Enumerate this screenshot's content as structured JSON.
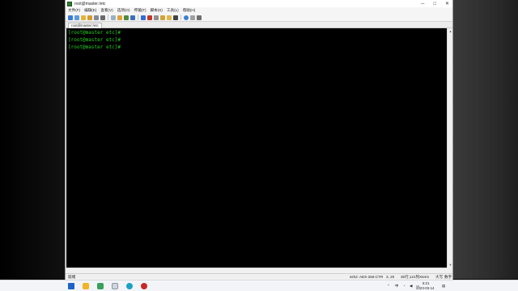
{
  "window": {
    "title": "root@master:/etc",
    "controls": {
      "minimize": "─",
      "maximize": "□",
      "close": "✕"
    }
  },
  "menu": [
    "文件(F)",
    "编辑(E)",
    "查看(V)",
    "选项(O)",
    "传输(T)",
    "脚本(S)",
    "工具(L)",
    "帮助(H)"
  ],
  "tab": {
    "label": "root@master:/etc"
  },
  "terminal": {
    "lines": [
      "[root@master etc]#",
      "[root@master etc]#",
      "[root@master etc]#"
    ],
    "text_color": "#22d022"
  },
  "status": {
    "left": "就绪",
    "cipher": "ssh2: AES-256-CTR",
    "cursor": "3, 20",
    "size": "35行,121列",
    "term": "Xterm",
    "caps": "大写",
    "num": "数字"
  },
  "taskbar": {
    "time": "8:21",
    "date": "2023-03-14",
    "ime": "中"
  }
}
